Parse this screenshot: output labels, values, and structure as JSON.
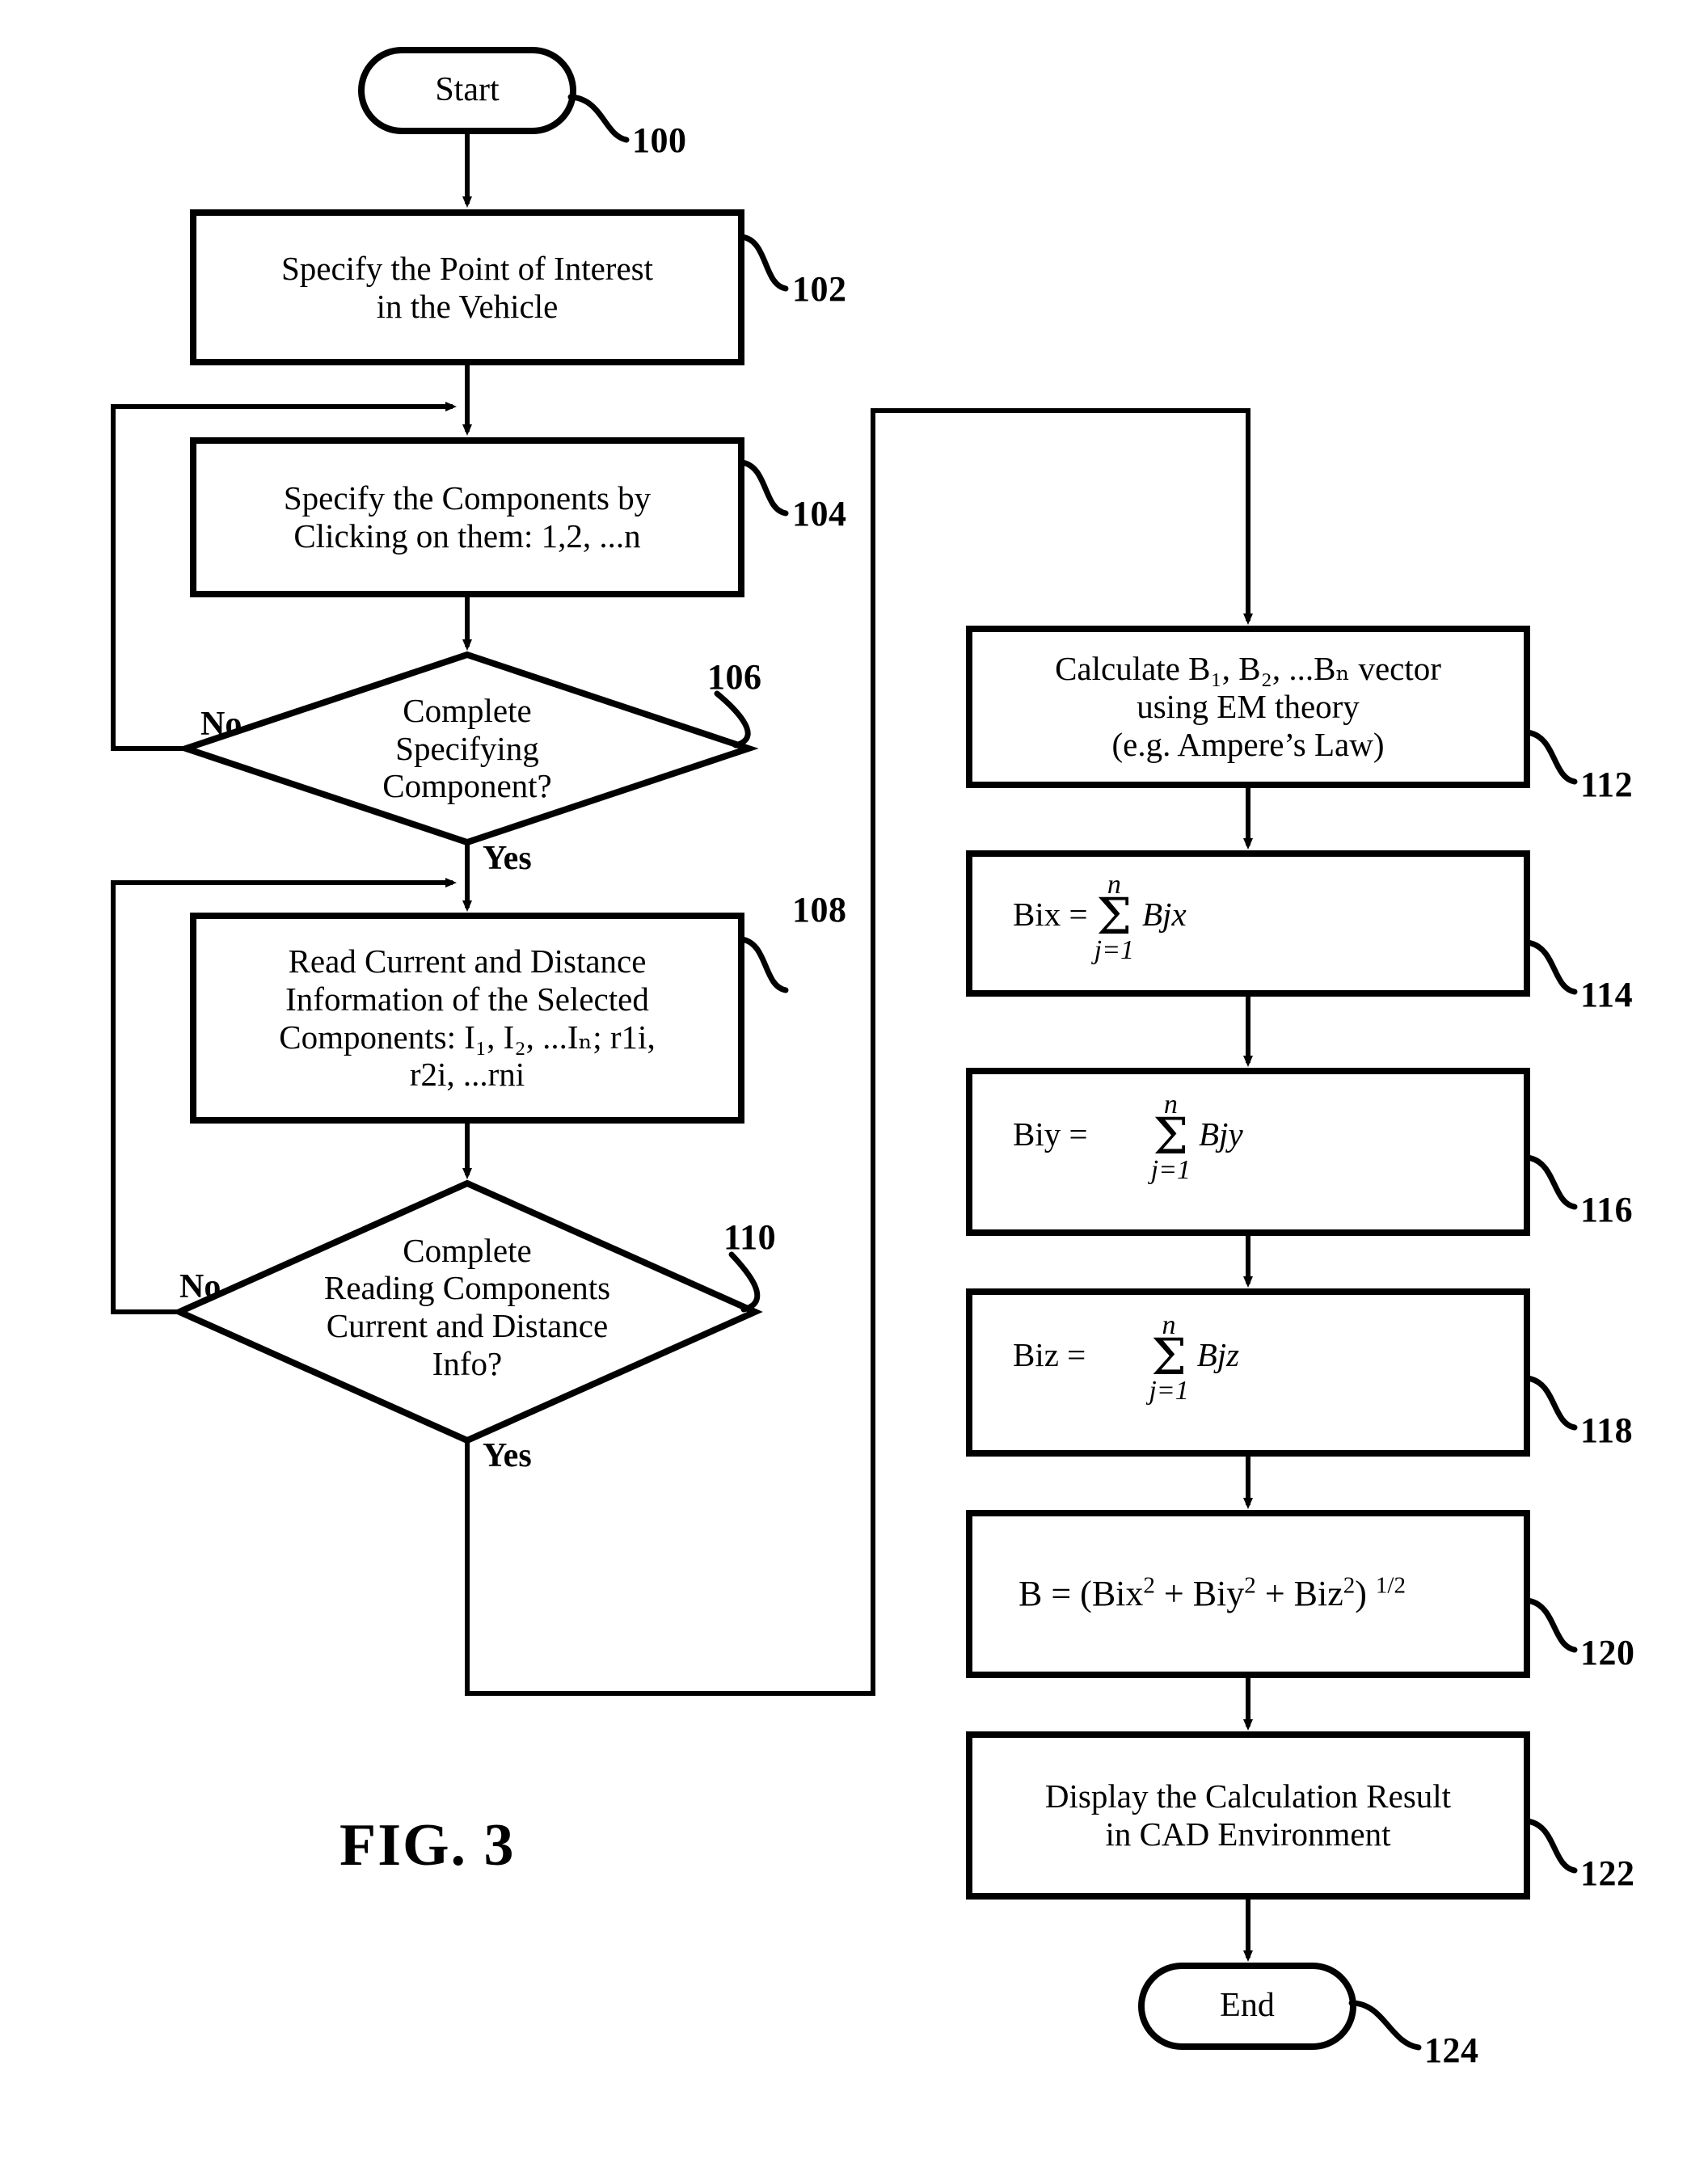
{
  "figure": {
    "label": "FIG.  3",
    "title": "FIG. 3"
  },
  "nodes": {
    "start": {
      "label": "Start",
      "ref": "100",
      "shape": "terminator"
    },
    "specify_point": {
      "label": "Specify the Point of Interest\nin the Vehicle",
      "ref": "102",
      "shape": "process"
    },
    "specify_components": {
      "label": "Specify the Components by\nClicking on them: 1,2, ...n",
      "ref": "104",
      "shape": "process"
    },
    "decision_specify": {
      "label": "Complete\nSpecifying\nComponent?",
      "ref": "106",
      "shape": "decision"
    },
    "read_info": {
      "label": "Read Current and Distance\nInformation of the Selected\nComponents: I₁, I₂, ...Iₙ; r1i,\nr2i, ...rni",
      "ref": "108",
      "shape": "process"
    },
    "decision_read": {
      "label": "Complete\nReading Components\nCurrent and Distance\nInfo?",
      "ref": "110",
      "shape": "decision"
    },
    "calculate_b": {
      "label": "Calculate B₁, B₂, ...Bₙ vector\nusing EM theory\n(e.g. Ampere’s Law)",
      "ref": "112",
      "shape": "process"
    },
    "bix": {
      "ref": "114",
      "shape": "process",
      "lhs": "Bix =",
      "sum_top": "n",
      "sum_bottom": "j=1",
      "operand": "Bjx"
    },
    "biy": {
      "ref": "116",
      "shape": "process",
      "lhs": "Biy =",
      "sum_top": "n",
      "sum_bottom": "j=1",
      "operand": "Bjy"
    },
    "biz": {
      "ref": "118",
      "shape": "process",
      "lhs": "Biz =",
      "sum_top": "n",
      "sum_bottom": "j=1",
      "operand": "Bjz"
    },
    "magnitude": {
      "ref": "120",
      "shape": "process",
      "formula_plain": "B = (Bix2 + Biy2 + Biz2) 1/2"
    },
    "display": {
      "label": "Display the Calculation Result\nin CAD Environment",
      "ref": "122",
      "shape": "process"
    },
    "end": {
      "label": "End",
      "ref": "124",
      "shape": "terminator"
    }
  },
  "branches": {
    "no_specify": "No",
    "yes_specify": "Yes",
    "no_read": "No",
    "yes_read": "Yes"
  },
  "colors": {
    "stroke": "#000000",
    "background": "#ffffff"
  }
}
